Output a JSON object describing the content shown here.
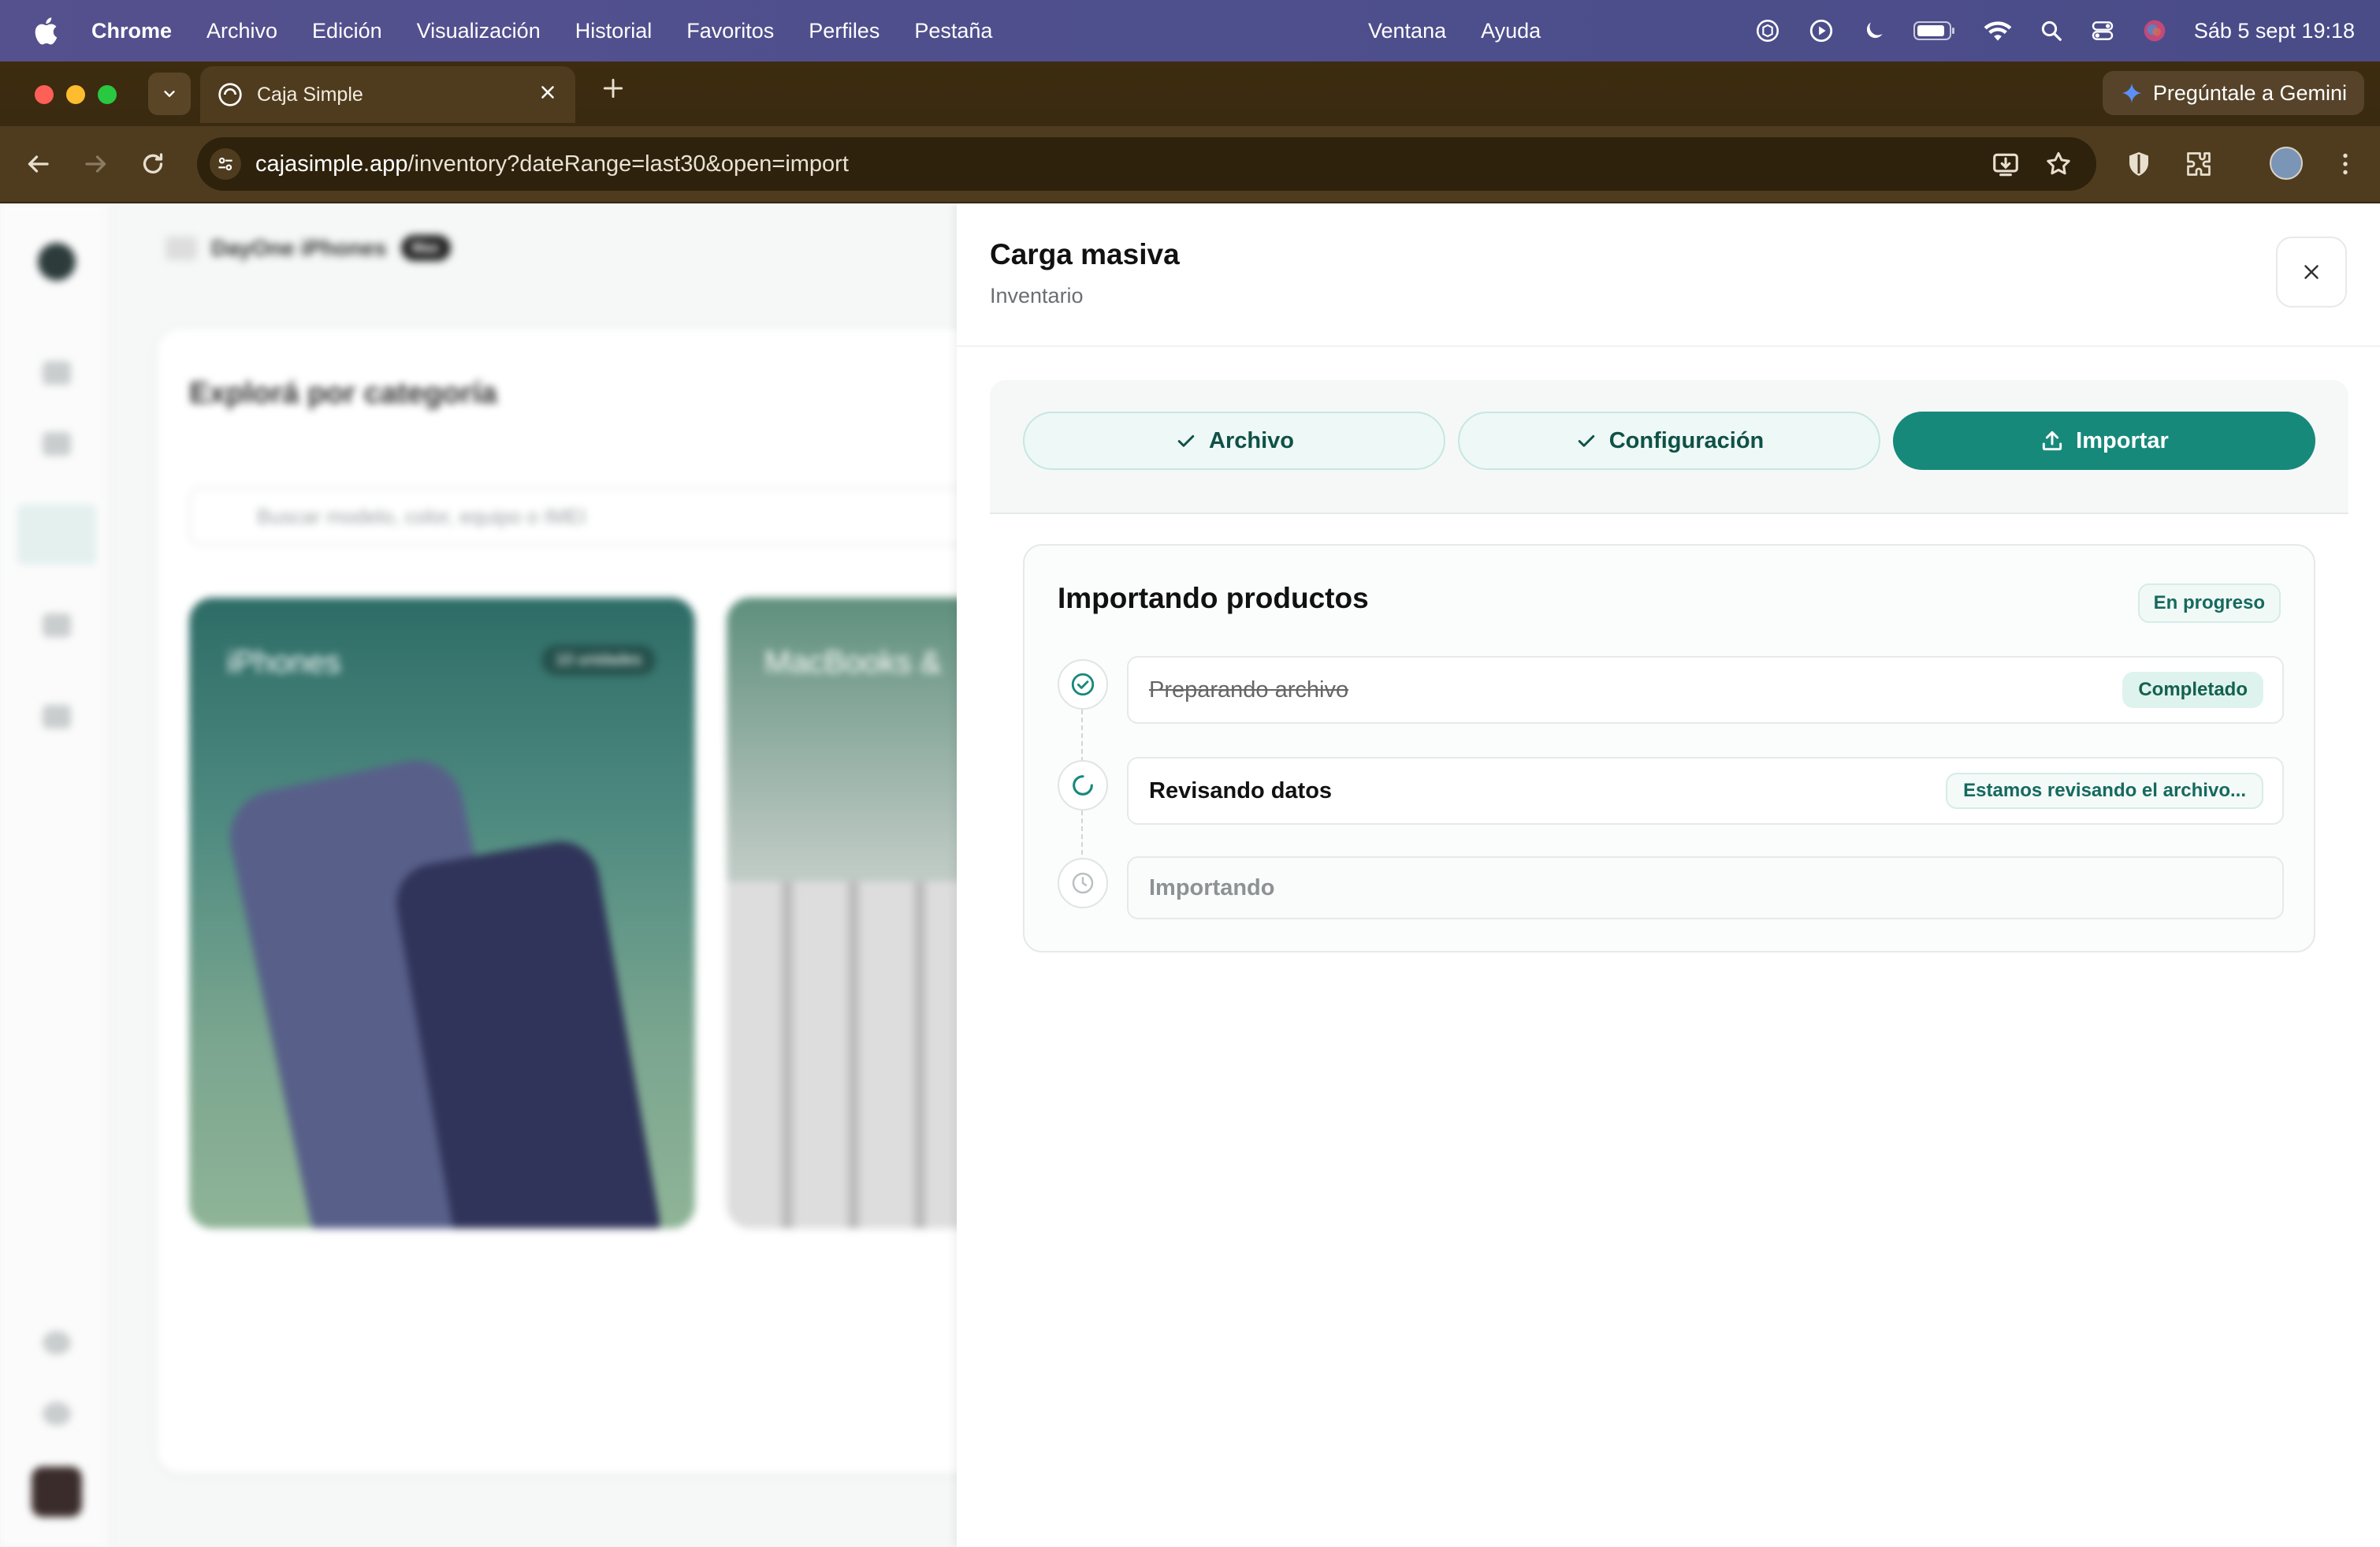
{
  "menubar": {
    "app": "Chrome",
    "menus": [
      "Archivo",
      "Edición",
      "Visualización",
      "Historial",
      "Favoritos",
      "Perfiles",
      "Pestaña"
    ],
    "menus_right": [
      "Ventana",
      "Ayuda"
    ],
    "datetime": "Sáb 5 sept  19:18"
  },
  "browser": {
    "tab_title": "Caja Simple",
    "gemini_label": "Pregúntale a Gemini",
    "url_host": "cajasimple.app",
    "url_path": "/inventory?dateRange=last30&open=import"
  },
  "background_app": {
    "store_name": "DayOne iPhones",
    "plan_badge": "Max",
    "section_title": "Explorá por categoría",
    "search_placeholder": "Buscar modelo, color, equipo o IMEI",
    "categories": [
      {
        "label": "iPhones",
        "badge": "10 unidades"
      },
      {
        "label": "MacBooks &"
      }
    ]
  },
  "drawer": {
    "title": "Carga masiva",
    "subtitle": "Inventario",
    "steps": [
      {
        "label": "Archivo",
        "state": "done",
        "icon": "check-icon"
      },
      {
        "label": "Configuración",
        "state": "done",
        "icon": "check-icon"
      },
      {
        "label": "Importar",
        "state": "active",
        "icon": "upload-icon"
      }
    ],
    "import": {
      "title": "Importando productos",
      "status": "En progreso",
      "tasks": [
        {
          "label": "Preparando archivo",
          "badge": "Completado",
          "state": "complete",
          "icon": "check-circle-icon"
        },
        {
          "label": "Revisando datos",
          "badge": "Estamos revisando el archivo...",
          "state": "current",
          "icon": "spinner-icon"
        },
        {
          "label": "Importando",
          "badge": "",
          "state": "pending",
          "icon": "clock-icon"
        }
      ]
    }
  },
  "colors": {
    "accent": "#17897b",
    "menubar": "#4e4f8d",
    "chrome_frame": "#3d2c0f"
  }
}
